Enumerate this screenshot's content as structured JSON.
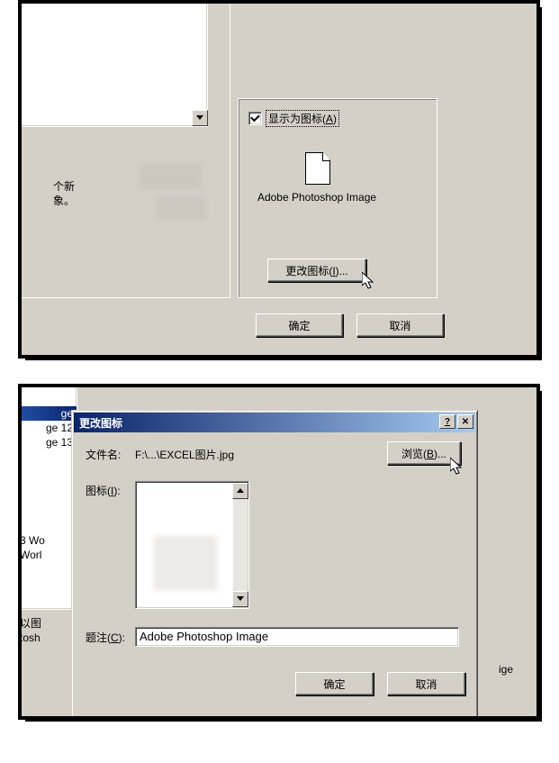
{
  "top": {
    "checkbox_label_pre": "显示为图标(",
    "checkbox_accel": "A",
    "checkbox_label_post": ")",
    "icon_caption": "Adobe Photoshop Image",
    "desc1": "个新",
    "desc2": "象。",
    "change_icon_pre": "更改图标(",
    "change_icon_accel": "I",
    "change_icon_post": ")...",
    "ok": "确定",
    "cancel": "取消"
  },
  "bot": {
    "list_sel": "ge",
    "list_r1": "ge 12",
    "list_r2": "ge 13",
    "side1": "3 Wo",
    "side2": "Worl",
    "side3": "以图",
    "side4": "tosh",
    "side5": "ige",
    "title": "更改图标",
    "filename_label_pre": "文件名",
    "filename_label_post": ":",
    "filename_value": "F:\\...\\EXCEL图片.jpg",
    "browse_pre": "浏览(",
    "browse_accel": "B",
    "browse_post": ")...",
    "icon_label_pre": "图标(",
    "icon_label_accel": "I",
    "icon_label_post": "):",
    "caption_label_pre": "题注(",
    "caption_label_accel": "C",
    "caption_label_post": "):",
    "caption_value": "Adobe Photoshop Image",
    "ok": "确定",
    "cancel": "取消"
  }
}
